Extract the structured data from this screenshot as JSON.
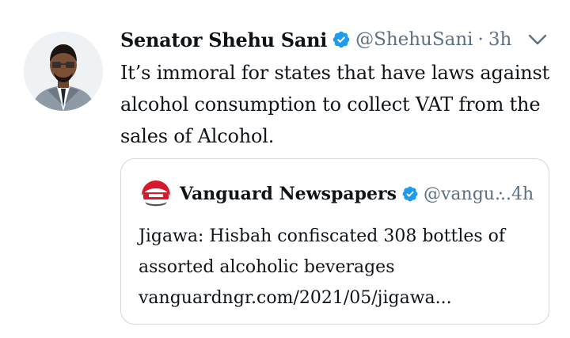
{
  "tweet": {
    "author_name": "Senator Shehu Sani",
    "author_handle": "@ShehuSani",
    "separator": "·",
    "time": "3h",
    "text": "It’s immoral for states that have laws against alcohol consumption to collect VAT from the sales of Alcohol.",
    "avatar_icon": "cartoon-avatar-icon",
    "verified_icon": "verified-badge-icon",
    "more_icon": "chevron-down-icon"
  },
  "quoted_tweet": {
    "author_name": "Vanguard Newspapers",
    "author_handle": "@vangu...",
    "separator": "·",
    "time": "4h",
    "text_line1": "Jigawa: Hisbah confiscated 308 bottles of",
    "text_line2": "assorted alcoholic beverages",
    "link": "vanguardngr.com/2021/05/jigawa...",
    "logo_icon": "vanguard-logo-icon"
  },
  "colors": {
    "text": "#0f1419",
    "secondary": "#5b7083",
    "verified": "#1d9bf0",
    "border": "#cfd9de",
    "brand_red": "#d7192a"
  }
}
